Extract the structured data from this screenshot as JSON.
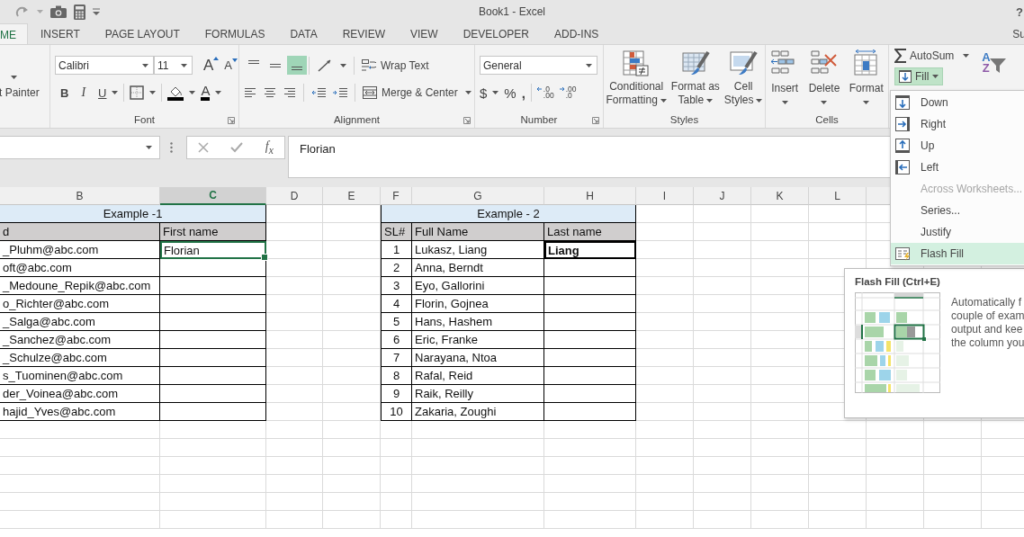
{
  "title_bar": {
    "title": "Book1 - Excel",
    "help": "?"
  },
  "tabs": [
    {
      "label": "ME",
      "selected": true
    },
    {
      "label": "INSERT",
      "selected": false
    },
    {
      "label": "PAGE LAYOUT",
      "selected": false
    },
    {
      "label": "FORMULAS",
      "selected": false
    },
    {
      "label": "DATA",
      "selected": false
    },
    {
      "label": "REVIEW",
      "selected": false
    },
    {
      "label": "VIEW",
      "selected": false
    },
    {
      "label": "DEVELOPER",
      "selected": false
    },
    {
      "label": "ADD-INS",
      "selected": false
    }
  ],
  "account": "Su",
  "ribbon": {
    "clipboard": {
      "format_painter": "t Painter"
    },
    "font": {
      "label": "Font",
      "name": "Calibri",
      "size": "11",
      "grow": "A",
      "shrink": "A",
      "bold": "B",
      "italic": "I",
      "underline": "U",
      "font_color": "A"
    },
    "alignment": {
      "label": "Alignment",
      "vertical": [
        {
          "kind": "top",
          "selected": false
        },
        {
          "kind": "middle",
          "selected": false
        },
        {
          "kind": "bottom",
          "selected": true
        }
      ],
      "wrap_text": "Wrap Text",
      "merge_center": "Merge & Center"
    },
    "number": {
      "label": "Number",
      "format": "General",
      "currency": "$",
      "percent": "%",
      "comma": ",",
      "increase_decimal": [
        ".0",
        ".00"
      ],
      "decrease_decimal": [
        ".00",
        ".0"
      ]
    },
    "styles": {
      "label": "Styles",
      "buttons": [
        {
          "kind": "conditional",
          "lines": [
            "Conditional",
            "Formatting"
          ]
        },
        {
          "kind": "table",
          "lines": [
            "Format as",
            "Table"
          ]
        },
        {
          "kind": "cell",
          "lines": [
            "Cell",
            "Styles"
          ]
        }
      ]
    },
    "cells": {
      "label": "Cells",
      "buttons": [
        {
          "kind": "insert",
          "label": "Insert"
        },
        {
          "kind": "delete",
          "label": "Delete"
        },
        {
          "kind": "format",
          "label": "Format"
        }
      ]
    },
    "editing": {
      "autosum": "AutoSum",
      "fill": {
        "label": "Fill",
        "expanded": true
      },
      "sort_letters": [
        "A",
        "Z"
      ]
    }
  },
  "formula_bar": {
    "function": "f$_{x}$",
    "value": "Florian"
  },
  "sheet": {
    "columns": [
      {
        "label": "B",
        "selected": false
      },
      {
        "label": "C",
        "selected": true
      },
      {
        "label": "D",
        "selected": false
      },
      {
        "label": "E",
        "selected": false
      },
      {
        "label": "F",
        "selected": false
      },
      {
        "label": "G",
        "selected": false
      },
      {
        "label": "H",
        "selected": false
      },
      {
        "label": "I",
        "selected": false
      },
      {
        "label": "J",
        "selected": false
      },
      {
        "label": "K",
        "selected": false
      },
      {
        "label": "L",
        "selected": false
      }
    ],
    "table1": {
      "title": "Example -1",
      "columns": [
        "d",
        "First name"
      ],
      "rows": [
        {
          "email": "_Pluhm@abc.com",
          "first_name": "Florian",
          "selected": true
        },
        {
          "email": "oft@abc.com",
          "selected": false
        },
        {
          "email": "_Medoune_Repik@abc.com",
          "selected": false
        },
        {
          "email": "o_Richter@abc.com",
          "selected": false
        },
        {
          "email": "_Salga@abc.com",
          "selected": false
        },
        {
          "email": "_Sanchez@abc.com",
          "selected": false
        },
        {
          "email": "_Schulze@abc.com",
          "selected": false
        },
        {
          "email": "s_Tuominen@abc.com",
          "selected": false
        },
        {
          "email": "der_Voinea@abc.com",
          "selected": false
        },
        {
          "email": "hajid_Yves@abc.com",
          "selected": false
        }
      ]
    },
    "table2": {
      "title": "Example - 2",
      "columns": [
        "SL#",
        "Full Name",
        "Last name"
      ],
      "rows": [
        {
          "sl": "1",
          "full_name": "Lukasz, Liang",
          "last_name": "Liang",
          "emphasized": true
        },
        {
          "sl": "2",
          "full_name": "Anna, Berndt",
          "emphasized": false
        },
        {
          "sl": "3",
          "full_name": "Eyo, Gallorini",
          "emphasized": false
        },
        {
          "sl": "4",
          "full_name": "Florin, Gojnea",
          "emphasized": false
        },
        {
          "sl": "5",
          "full_name": "Hans, Hashem",
          "emphasized": false
        },
        {
          "sl": "6",
          "full_name": "Eric, Franke",
          "emphasized": false
        },
        {
          "sl": "7",
          "full_name": "Narayana, Ntoa",
          "emphasized": false
        },
        {
          "sl": "8",
          "full_name": "Rafal, Reid",
          "emphasized": false
        },
        {
          "sl": "9",
          "full_name": "Raik, Reilly",
          "emphasized": false
        },
        {
          "sl": "10",
          "full_name": "Zakaria, Zoughi",
          "emphasized": false
        }
      ]
    }
  },
  "fill_menu": [
    {
      "kind": "down",
      "label": "Down",
      "disabled": false,
      "selected": false
    },
    {
      "kind": "right",
      "label": "Right",
      "disabled": false,
      "selected": false
    },
    {
      "kind": "up",
      "label": "Up",
      "disabled": false,
      "selected": false
    },
    {
      "kind": "left",
      "label": "Left",
      "disabled": false,
      "selected": false
    },
    {
      "kind": "plain",
      "label": "Across Worksheets...",
      "disabled": true,
      "selected": false
    },
    {
      "kind": "plain",
      "label": "Series...",
      "disabled": false,
      "selected": false
    },
    {
      "kind": "plain",
      "label": "Justify",
      "disabled": false,
      "selected": false
    },
    {
      "kind": "flash",
      "label": "Flash Fill",
      "disabled": false,
      "selected": true
    }
  ],
  "tooltip": {
    "title": "Flash Fill (Ctrl+E)",
    "text": "Automatically f\ncouple of exam\noutput and kee\nthe column you"
  }
}
